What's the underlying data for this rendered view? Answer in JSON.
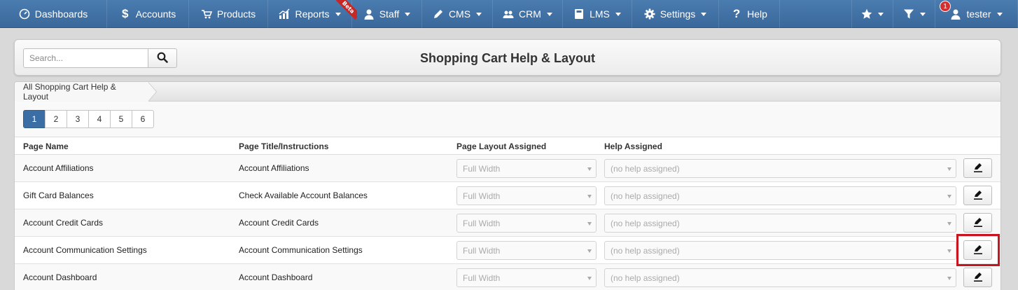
{
  "nav": {
    "items": [
      {
        "label": "Dashboards",
        "icon": "dashboard-icon",
        "caret": false
      },
      {
        "label": "Accounts",
        "icon": "dollar-icon",
        "caret": false
      },
      {
        "label": "Products",
        "icon": "cart-icon",
        "caret": false
      },
      {
        "label": "Reports",
        "icon": "chart-icon",
        "caret": true,
        "badge": "Beta"
      },
      {
        "label": "Staff",
        "icon": "user-icon",
        "caret": true
      },
      {
        "label": "CMS",
        "icon": "pencil-icon",
        "caret": true
      },
      {
        "label": "CRM",
        "icon": "users-icon",
        "caret": true
      },
      {
        "label": "LMS",
        "icon": "book-icon",
        "caret": true
      },
      {
        "label": "Settings",
        "icon": "gear-icon",
        "caret": true
      },
      {
        "label": "Help",
        "icon": "question-icon",
        "caret": false
      }
    ],
    "right": {
      "favorites_icon": "star-icon",
      "filter_icon": "filter-icon",
      "user_label": "tester",
      "notification_count": "1"
    }
  },
  "header": {
    "search_placeholder": "Search...",
    "title": "Shopping Cart Help & Layout"
  },
  "breadcrumb": "All Shopping Cart Help & Layout",
  "pager": {
    "pages": [
      "1",
      "2",
      "3",
      "4",
      "5",
      "6"
    ],
    "active": "1"
  },
  "table": {
    "columns": [
      "Page Name",
      "Page Title/Instructions",
      "Page Layout Assigned",
      "Help Assigned"
    ],
    "rows": [
      {
        "name": "Account Affiliations",
        "title": "Account Affiliations",
        "layout": "Full Width",
        "help": "(no help assigned)"
      },
      {
        "name": "Gift Card Balances",
        "title": "Check Available Account Balances",
        "layout": "Full Width",
        "help": "(no help assigned)"
      },
      {
        "name": "Account Credit Cards",
        "title": "Account Credit Cards",
        "layout": "Full Width",
        "help": "(no help assigned)"
      },
      {
        "name": "Account Communication Settings",
        "title": "Account Communication Settings",
        "layout": "Full Width",
        "help": "(no help assigned)"
      },
      {
        "name": "Account Dashboard",
        "title": "Account Dashboard",
        "layout": "Full Width",
        "help": "(no help assigned)"
      }
    ]
  },
  "colors": {
    "nav_bg": "#3f70a3",
    "active_page": "#3a6ea5",
    "highlight": "#c8141e"
  }
}
